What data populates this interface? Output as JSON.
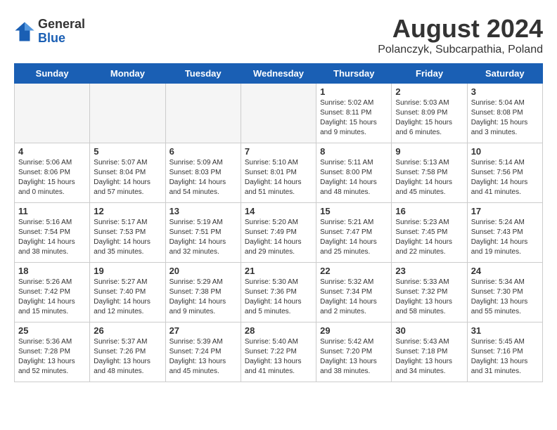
{
  "logo": {
    "general": "General",
    "blue": "Blue"
  },
  "title": "August 2024",
  "subtitle": "Polanczyk, Subcarpathia, Poland",
  "days_of_week": [
    "Sunday",
    "Monday",
    "Tuesday",
    "Wednesday",
    "Thursday",
    "Friday",
    "Saturday"
  ],
  "weeks": [
    [
      {
        "day": "",
        "info": ""
      },
      {
        "day": "",
        "info": ""
      },
      {
        "day": "",
        "info": ""
      },
      {
        "day": "",
        "info": ""
      },
      {
        "day": "1",
        "info": "Sunrise: 5:02 AM\nSunset: 8:11 PM\nDaylight: 15 hours and 9 minutes."
      },
      {
        "day": "2",
        "info": "Sunrise: 5:03 AM\nSunset: 8:09 PM\nDaylight: 15 hours and 6 minutes."
      },
      {
        "day": "3",
        "info": "Sunrise: 5:04 AM\nSunset: 8:08 PM\nDaylight: 15 hours and 3 minutes."
      }
    ],
    [
      {
        "day": "4",
        "info": "Sunrise: 5:06 AM\nSunset: 8:06 PM\nDaylight: 15 hours and 0 minutes."
      },
      {
        "day": "5",
        "info": "Sunrise: 5:07 AM\nSunset: 8:04 PM\nDaylight: 14 hours and 57 minutes."
      },
      {
        "day": "6",
        "info": "Sunrise: 5:09 AM\nSunset: 8:03 PM\nDaylight: 14 hours and 54 minutes."
      },
      {
        "day": "7",
        "info": "Sunrise: 5:10 AM\nSunset: 8:01 PM\nDaylight: 14 hours and 51 minutes."
      },
      {
        "day": "8",
        "info": "Sunrise: 5:11 AM\nSunset: 8:00 PM\nDaylight: 14 hours and 48 minutes."
      },
      {
        "day": "9",
        "info": "Sunrise: 5:13 AM\nSunset: 7:58 PM\nDaylight: 14 hours and 45 minutes."
      },
      {
        "day": "10",
        "info": "Sunrise: 5:14 AM\nSunset: 7:56 PM\nDaylight: 14 hours and 41 minutes."
      }
    ],
    [
      {
        "day": "11",
        "info": "Sunrise: 5:16 AM\nSunset: 7:54 PM\nDaylight: 14 hours and 38 minutes."
      },
      {
        "day": "12",
        "info": "Sunrise: 5:17 AM\nSunset: 7:53 PM\nDaylight: 14 hours and 35 minutes."
      },
      {
        "day": "13",
        "info": "Sunrise: 5:19 AM\nSunset: 7:51 PM\nDaylight: 14 hours and 32 minutes."
      },
      {
        "day": "14",
        "info": "Sunrise: 5:20 AM\nSunset: 7:49 PM\nDaylight: 14 hours and 29 minutes."
      },
      {
        "day": "15",
        "info": "Sunrise: 5:21 AM\nSunset: 7:47 PM\nDaylight: 14 hours and 25 minutes."
      },
      {
        "day": "16",
        "info": "Sunrise: 5:23 AM\nSunset: 7:45 PM\nDaylight: 14 hours and 22 minutes."
      },
      {
        "day": "17",
        "info": "Sunrise: 5:24 AM\nSunset: 7:43 PM\nDaylight: 14 hours and 19 minutes."
      }
    ],
    [
      {
        "day": "18",
        "info": "Sunrise: 5:26 AM\nSunset: 7:42 PM\nDaylight: 14 hours and 15 minutes."
      },
      {
        "day": "19",
        "info": "Sunrise: 5:27 AM\nSunset: 7:40 PM\nDaylight: 14 hours and 12 minutes."
      },
      {
        "day": "20",
        "info": "Sunrise: 5:29 AM\nSunset: 7:38 PM\nDaylight: 14 hours and 9 minutes."
      },
      {
        "day": "21",
        "info": "Sunrise: 5:30 AM\nSunset: 7:36 PM\nDaylight: 14 hours and 5 minutes."
      },
      {
        "day": "22",
        "info": "Sunrise: 5:32 AM\nSunset: 7:34 PM\nDaylight: 14 hours and 2 minutes."
      },
      {
        "day": "23",
        "info": "Sunrise: 5:33 AM\nSunset: 7:32 PM\nDaylight: 13 hours and 58 minutes."
      },
      {
        "day": "24",
        "info": "Sunrise: 5:34 AM\nSunset: 7:30 PM\nDaylight: 13 hours and 55 minutes."
      }
    ],
    [
      {
        "day": "25",
        "info": "Sunrise: 5:36 AM\nSunset: 7:28 PM\nDaylight: 13 hours and 52 minutes."
      },
      {
        "day": "26",
        "info": "Sunrise: 5:37 AM\nSunset: 7:26 PM\nDaylight: 13 hours and 48 minutes."
      },
      {
        "day": "27",
        "info": "Sunrise: 5:39 AM\nSunset: 7:24 PM\nDaylight: 13 hours and 45 minutes."
      },
      {
        "day": "28",
        "info": "Sunrise: 5:40 AM\nSunset: 7:22 PM\nDaylight: 13 hours and 41 minutes."
      },
      {
        "day": "29",
        "info": "Sunrise: 5:42 AM\nSunset: 7:20 PM\nDaylight: 13 hours and 38 minutes."
      },
      {
        "day": "30",
        "info": "Sunrise: 5:43 AM\nSunset: 7:18 PM\nDaylight: 13 hours and 34 minutes."
      },
      {
        "day": "31",
        "info": "Sunrise: 5:45 AM\nSunset: 7:16 PM\nDaylight: 13 hours and 31 minutes."
      }
    ]
  ]
}
